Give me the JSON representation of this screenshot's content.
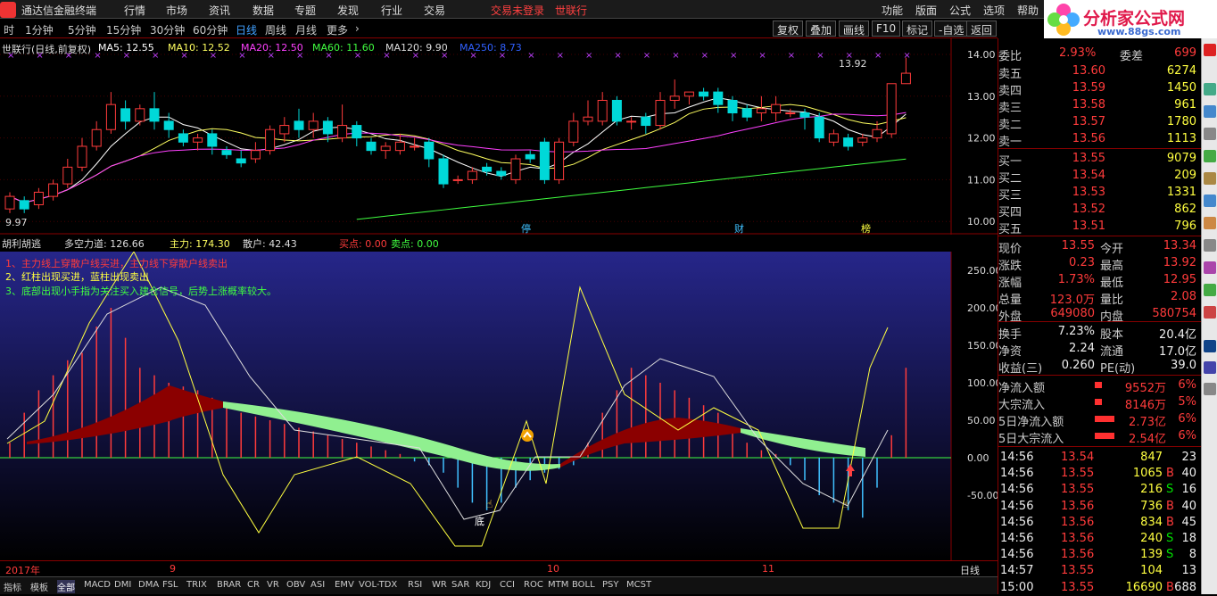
{
  "menu": {
    "app_title": "通达信金融终端",
    "items": [
      "行情",
      "市场",
      "资讯",
      "数据",
      "专题",
      "发现",
      "行业",
      "交易"
    ],
    "login": "交易未登录",
    "stock_name": "世联行",
    "right_items": [
      "功能",
      "版面",
      "公式",
      "选项",
      "帮助"
    ]
  },
  "watermark": {
    "site": "分析家公式网",
    "url": "www.88gs.com"
  },
  "toolbar": {
    "periods": [
      "时",
      "1分钟",
      "5分钟",
      "15分钟",
      "30分钟",
      "60分钟",
      "日线",
      "周线",
      "月线",
      "更多"
    ],
    "active_period": "日线",
    "buttons": [
      "复权",
      "叠加",
      "画线",
      "F10",
      "标记",
      "-自选",
      "返回"
    ]
  },
  "ma_bar": {
    "title": "世联行(日线,前复权)",
    "ma5": "MA5: 12.55",
    "ma10": "MA10: 12.52",
    "ma20": "MA20: 12.50",
    "ma60": "MA60: 11.60",
    "ma120": "MA120: 9.90",
    "ma250": "MA250: 8.73"
  },
  "kline": {
    "high_label": "13.92",
    "low_label": "9.97",
    "price_axis": [
      "14.00",
      "13.00",
      "12.00",
      "11.00",
      "10.00"
    ],
    "markers": [
      "停",
      "财",
      "榜"
    ],
    "candles": [
      [
        10.3,
        10.6,
        10.2,
        10.7
      ],
      [
        10.5,
        10.3,
        10.2,
        10.6
      ],
      [
        10.4,
        10.7,
        10.3,
        10.8
      ],
      [
        10.6,
        10.9,
        10.5,
        11.0
      ],
      [
        10.9,
        11.3,
        10.8,
        11.5
      ],
      [
        11.3,
        11.8,
        11.2,
        12.0
      ],
      [
        11.8,
        12.2,
        11.7,
        12.4
      ],
      [
        12.2,
        12.8,
        12.1,
        13.1
      ],
      [
        12.7,
        12.4,
        12.2,
        12.9
      ],
      [
        12.4,
        12.7,
        12.3,
        12.8
      ],
      [
        12.7,
        12.4,
        12.2,
        13.1
      ],
      [
        12.4,
        12.2,
        12.0,
        12.6
      ],
      [
        12.1,
        11.9,
        11.8,
        12.2
      ],
      [
        11.9,
        12.0,
        11.7,
        12.1
      ],
      [
        12.1,
        11.8,
        11.6,
        12.2
      ],
      [
        11.7,
        11.6,
        11.5,
        11.8
      ],
      [
        11.5,
        11.4,
        11.3,
        11.7
      ],
      [
        11.5,
        11.7,
        11.4,
        11.9
      ],
      [
        11.7,
        12.2,
        11.6,
        12.3
      ],
      [
        12.1,
        12.3,
        11.9,
        12.5
      ],
      [
        12.4,
        12.2,
        12.0,
        12.7
      ],
      [
        12.2,
        12.4,
        12.0,
        12.6
      ],
      [
        12.4,
        12.1,
        11.9,
        12.5
      ],
      [
        12.0,
        12.3,
        11.9,
        12.8
      ],
      [
        12.3,
        12.0,
        11.8,
        12.4
      ],
      [
        11.9,
        11.7,
        11.6,
        12.0
      ],
      [
        11.7,
        11.8,
        11.5,
        11.9
      ],
      [
        11.7,
        11.9,
        11.6,
        12.1
      ],
      [
        11.8,
        11.8,
        11.7,
        12.0
      ],
      [
        11.9,
        11.5,
        11.3,
        12.0
      ],
      [
        11.5,
        10.9,
        10.8,
        11.6
      ],
      [
        11.0,
        11.0,
        10.9,
        11.1
      ],
      [
        11.0,
        11.2,
        10.9,
        11.3
      ],
      [
        11.3,
        11.2,
        11.1,
        11.4
      ],
      [
        11.2,
        11.1,
        11.0,
        11.3
      ],
      [
        11.0,
        11.5,
        10.9,
        11.6
      ],
      [
        11.6,
        11.5,
        11.4,
        11.7
      ],
      [
        11.9,
        11.0,
        10.9,
        12.0
      ],
      [
        11.0,
        11.9,
        10.9,
        12.0
      ],
      [
        11.9,
        12.4,
        11.8,
        12.6
      ],
      [
        12.4,
        12.5,
        12.3,
        12.9
      ],
      [
        12.4,
        12.9,
        12.3,
        13.1
      ],
      [
        12.9,
        12.4,
        12.3,
        13.0
      ],
      [
        12.4,
        12.4,
        12.2,
        12.5
      ],
      [
        12.5,
        12.3,
        12.1,
        12.6
      ],
      [
        12.3,
        12.9,
        12.2,
        13.1
      ],
      [
        12.9,
        13.0,
        12.7,
        13.4
      ],
      [
        13.0,
        13.1,
        12.8,
        13.1
      ],
      [
        13.1,
        13.0,
        12.9,
        13.2
      ],
      [
        13.1,
        12.8,
        12.6,
        13.2
      ],
      [
        12.9,
        12.6,
        12.4,
        13.0
      ],
      [
        12.7,
        12.5,
        12.4,
        12.8
      ],
      [
        12.6,
        12.7,
        12.4,
        13.0
      ],
      [
        12.6,
        12.8,
        12.4,
        13.0
      ],
      [
        12.6,
        12.6,
        12.5,
        12.7
      ],
      [
        12.6,
        12.5,
        12.2,
        12.7
      ],
      [
        12.5,
        12.0,
        11.9,
        12.6
      ],
      [
        11.9,
        12.1,
        11.8,
        12.2
      ],
      [
        12.0,
        11.8,
        11.7,
        12.1
      ],
      [
        11.9,
        12.0,
        11.8,
        12.1
      ],
      [
        12.0,
        12.2,
        11.9,
        12.4
      ],
      [
        12.1,
        13.3,
        12.0,
        13.3
      ],
      [
        13.3,
        13.55,
        13.3,
        13.92
      ]
    ]
  },
  "indicator": {
    "name": "胡利胡逃",
    "duokong": "多空力道: 126.66",
    "zhuli": "主力: 174.30",
    "sanhu": "散户: 42.43",
    "buy_pt": "买点: 0.00",
    "sell_pt": "卖点: 0.00",
    "notes": [
      "1、主力线上穿散户线买进，主力线下穿散户线卖出",
      "2、红柱出现买进，蓝柱出现卖出",
      "3、底部出现小手指为关注买入建仓信号，后势上涨概率较大。"
    ],
    "axis": [
      "250.00",
      "200.00",
      "150.00",
      "100.00",
      "50.00",
      "0.00",
      "-50.00"
    ],
    "bottom_marker": "底"
  },
  "dates": {
    "labels": [
      "2017年",
      "9",
      "10",
      "11"
    ],
    "period": "日线"
  },
  "quote": {
    "weibi": {
      "label": "委比",
      "value": "2.93%",
      "extra_label": "委差",
      "extra": "699"
    },
    "asks": [
      {
        "label": "卖五",
        "price": "13.60",
        "vol": "6274"
      },
      {
        "label": "卖四",
        "price": "13.59",
        "vol": "1450"
      },
      {
        "label": "卖三",
        "price": "13.58",
        "vol": "961"
      },
      {
        "label": "卖二",
        "price": "13.57",
        "vol": "1780"
      },
      {
        "label": "卖一",
        "price": "13.56",
        "vol": "1113"
      }
    ],
    "bids": [
      {
        "label": "买一",
        "price": "13.55",
        "vol": "9079"
      },
      {
        "label": "买二",
        "price": "13.54",
        "vol": "209"
      },
      {
        "label": "买三",
        "price": "13.53",
        "vol": "1331"
      },
      {
        "label": "买四",
        "price": "13.52",
        "vol": "862"
      },
      {
        "label": "买五",
        "price": "13.51",
        "vol": "796"
      }
    ],
    "stats": [
      {
        "l1": "现价",
        "v1": "13.55",
        "l2": "今开",
        "v2": "13.34"
      },
      {
        "l1": "涨跌",
        "v1": "0.23",
        "l2": "最高",
        "v2": "13.92"
      },
      {
        "l1": "涨幅",
        "v1": "1.73%",
        "l2": "最低",
        "v2": "12.95"
      },
      {
        "l1": "总量",
        "v1": "123.0万",
        "l2": "量比",
        "v2": "2.08"
      },
      {
        "l1": "外盘",
        "v1": "649080",
        "l2": "内盘",
        "v2": "580754"
      }
    ],
    "stats2": [
      {
        "l1": "换手",
        "v1": "7.23%",
        "l2": "股本",
        "v2": "20.4亿"
      },
      {
        "l1": "净资",
        "v1": "2.24",
        "l2": "流通",
        "v2": "17.0亿"
      },
      {
        "l1": "收益(三)",
        "v1": "0.260",
        "l2": "PE(动)",
        "v2": "39.0"
      }
    ],
    "flows": [
      {
        "label": "净流入额",
        "value": "9552万",
        "pct": "6%"
      },
      {
        "label": "大宗流入",
        "value": "8146万",
        "pct": "5%"
      },
      {
        "label": "5日净流入额",
        "value": "2.73亿",
        "pct": "6%"
      },
      {
        "label": "5日大宗流入",
        "value": "2.54亿",
        "pct": "6%"
      }
    ],
    "ticks": [
      {
        "t": "14:56",
        "p": "13.54",
        "v": "847",
        "s": "",
        "n": "23"
      },
      {
        "t": "14:56",
        "p": "13.55",
        "v": "1065",
        "s": "B",
        "n": "40"
      },
      {
        "t": "14:56",
        "p": "13.55",
        "v": "216",
        "s": "S",
        "n": "16"
      },
      {
        "t": "14:56",
        "p": "13.56",
        "v": "736",
        "s": "B",
        "n": "40"
      },
      {
        "t": "14:56",
        "p": "13.56",
        "v": "834",
        "s": "B",
        "n": "45"
      },
      {
        "t": "14:56",
        "p": "13.56",
        "v": "240",
        "s": "S",
        "n": "18"
      },
      {
        "t": "14:56",
        "p": "13.56",
        "v": "139",
        "s": "S",
        "n": "8"
      },
      {
        "t": "14:57",
        "p": "13.55",
        "v": "104",
        "s": "",
        "n": "13"
      },
      {
        "t": "15:00",
        "p": "13.55",
        "v": "16690",
        "s": "B",
        "n": "688"
      }
    ]
  },
  "tabs": [
    "指标",
    "模板",
    "全部",
    "MACD",
    "DMI",
    "DMA",
    "FSL",
    "TRIX",
    "BRAR",
    "CR",
    "VR",
    "OBV",
    "ASI",
    "EMV",
    "VOL-TDX",
    "RSI",
    "WR",
    "SAR",
    "KDJ",
    "CCI",
    "ROC",
    "MTM",
    "BOLL",
    "PSY",
    "MCST"
  ]
}
